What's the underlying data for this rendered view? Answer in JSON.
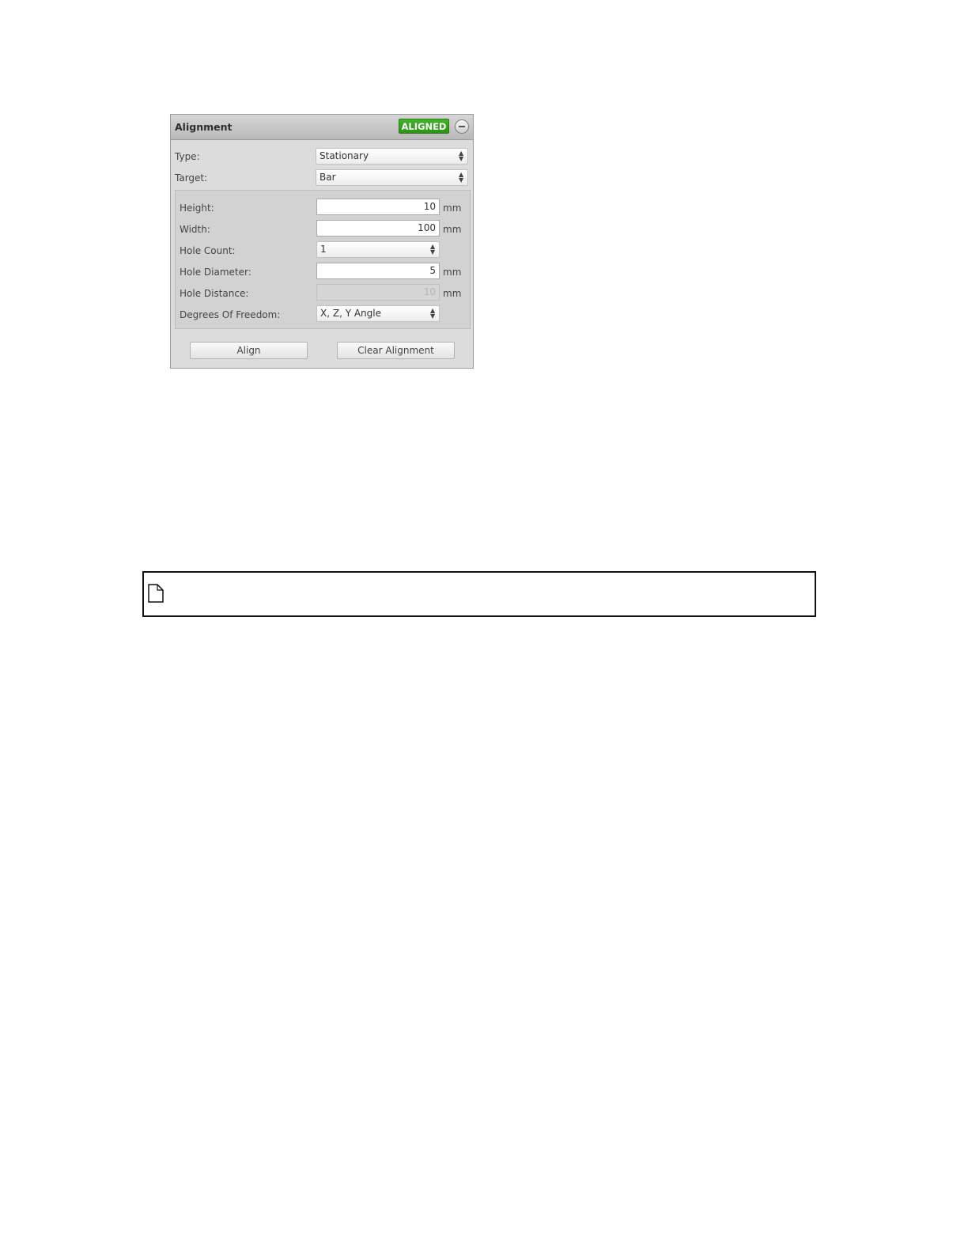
{
  "panel": {
    "title": "Alignment",
    "status": "ALIGNED",
    "status_color": "#3aa321",
    "collapse_icon": "minus-circle-icon"
  },
  "fields": {
    "type": {
      "label": "Type:",
      "value": "Stationary"
    },
    "target": {
      "label": "Target:",
      "value": "Bar"
    },
    "height": {
      "label": "Height:",
      "value": "10",
      "unit": "mm"
    },
    "width": {
      "label": "Width:",
      "value": "100",
      "unit": "mm"
    },
    "hole_count": {
      "label": "Hole Count:",
      "value": "1"
    },
    "hole_diameter": {
      "label": "Hole Diameter:",
      "value": "5",
      "unit": "mm"
    },
    "hole_distance": {
      "label": "Hole Distance:",
      "value": "10",
      "unit": "mm",
      "disabled": true
    },
    "degrees_of_freedom": {
      "label": "Degrees Of Freedom:",
      "value": "X, Z, Y Angle"
    }
  },
  "buttons": {
    "align": "Align",
    "clear": "Clear Alignment"
  },
  "placeholder": {
    "icon": "document-icon"
  }
}
